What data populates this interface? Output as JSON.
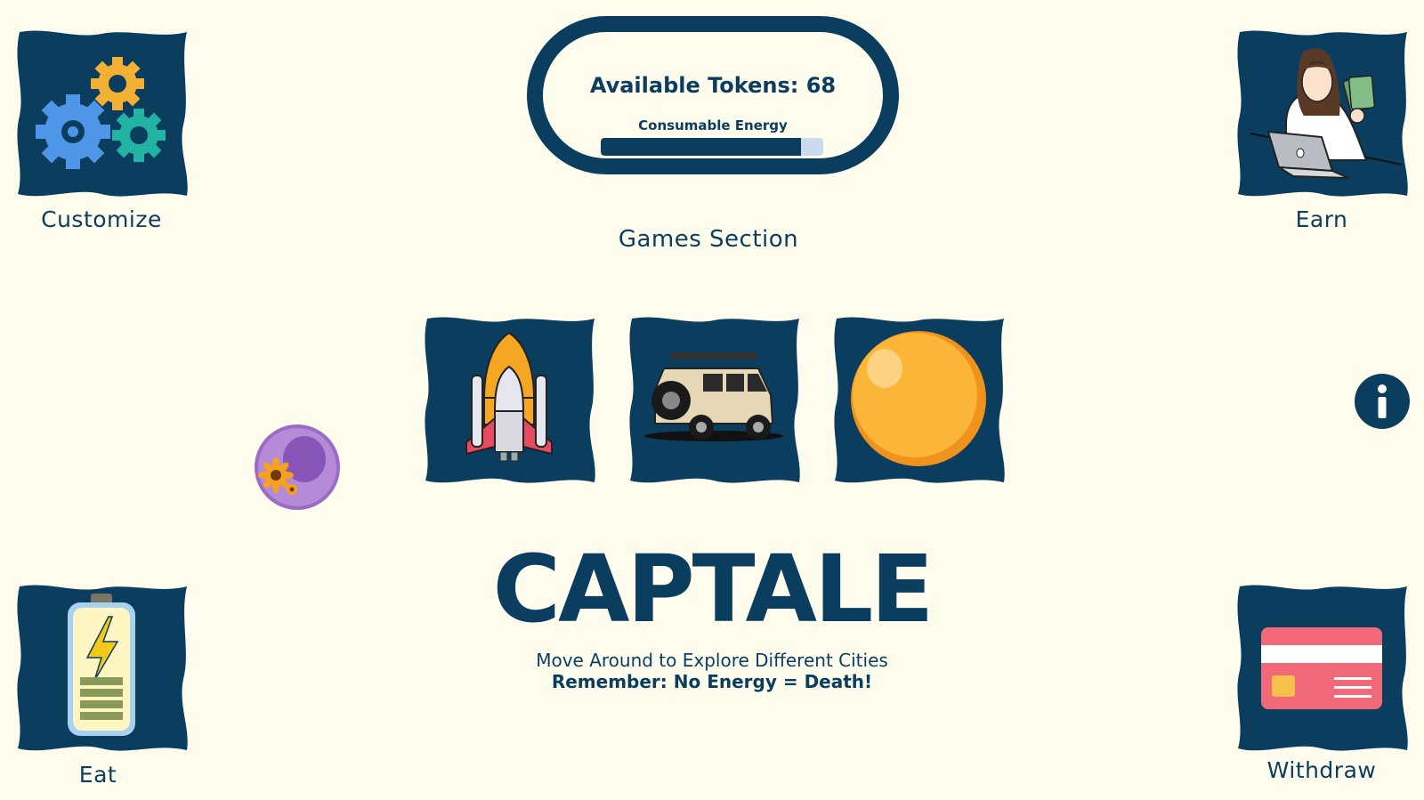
{
  "tokens": {
    "text": "Available Tokens: 68"
  },
  "energy": {
    "label": "Consumable Energy",
    "level_percent": 90
  },
  "games_heading": "Games Section",
  "menu": {
    "customize": "Customize",
    "earn": "Earn",
    "eat": "Eat",
    "withdraw": "Withdraw"
  },
  "games": [
    {
      "icon": "space-shuttle-icon"
    },
    {
      "icon": "jeep-icon"
    },
    {
      "icon": "orange-ball-icon"
    }
  ],
  "title": "CAPTALE",
  "subtitle": "Move Around to Explore Different Cities",
  "warning": "Remember: No Energy = Death!",
  "colors": {
    "background": "#fefcec",
    "navy": "#0b3d5e",
    "energy_track": "#c8dcec"
  }
}
